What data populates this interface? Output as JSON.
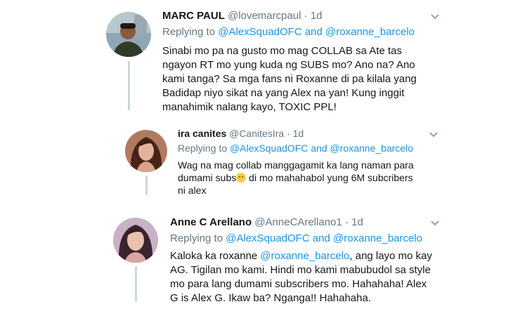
{
  "tweets": [
    {
      "name": "MARC PAUL",
      "handle": "@lovemarcpaul",
      "dot": "·",
      "time": "1d",
      "replying_to": "Replying to",
      "mention1": "@AlexSquadOFC",
      "and": "and",
      "mention2": "@roxanne_barcelo",
      "lines": [
        "Sinabi mo pa na gusto mo mag COLLAB sa Ate tas",
        "ngayon RT mo yung kuda ng SUBS mo? Ano na? Ano",
        "kami tanga? Sa mga fans ni Roxanne di pa kilala yang",
        "Badidap  niyo sikat na yang Alex na yan! Kung inggit",
        "manahimik nalang kayo, TOXIC PPL!"
      ]
    },
    {
      "name": "ira canites",
      "handle": "@CanitesIra",
      "dot": "·",
      "time": "1d",
      "replying_to": "Replying to",
      "mention1": "@AlexSquadOFC",
      "and": "and",
      "mention2": "@roxanne_barcelo",
      "line1": "Wag na mag collab manggagamit ka lang naman para",
      "line2a": "dumami subs",
      "line2b": " di mo mahahabol yung 6M  subcribers",
      "line3": "ni alex"
    },
    {
      "name": "Anne C Arellano",
      "handle": "@AnneCArellano1",
      "dot": "·",
      "time": "1d",
      "replying_to": "Replying to",
      "mention1": "@AlexSquadOFC",
      "and": "and",
      "mention2": "@roxanne_barcelo",
      "line1a": "Kaloka ka roxanne ",
      "line1m": "@roxanne_barcelo",
      "line1b": ", ang layo mo kay",
      "lines_rest": [
        "AG. Tigilan mo kami. Hindi mo kami mabubudol sa style",
        "mo para lang dumami subscribers mo. Hahahaha! Alex",
        "G is Alex G. Ikaw ba? Nganga!! Hahahaha."
      ]
    }
  ],
  "icons": {
    "avatar": "avatar",
    "menu": "chevron-down-icon",
    "emoji": "pensive-face-emoji"
  }
}
